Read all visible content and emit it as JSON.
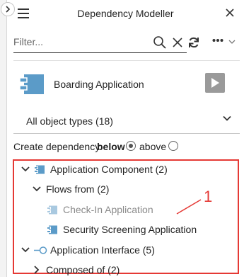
{
  "panel": {
    "title": "Dependency Modeller"
  },
  "filter": {
    "placeholder": "Filter..."
  },
  "element": {
    "label": "Boarding Application"
  },
  "object_types": {
    "selected": "All object types (18)"
  },
  "create_dependency": {
    "prefix": "Create dependency",
    "bold": "below",
    "below_selected": true,
    "above_label": "above"
  },
  "tree": [
    {
      "label": "Application Component (2)",
      "icon": "application-component-icon",
      "expanded": true
    },
    {
      "label": "Flows from (2)",
      "expanded": true
    },
    {
      "label": "Check-In Application",
      "icon": "application-component-icon",
      "disabled": true
    },
    {
      "label": "Security Screening Application",
      "icon": "application-component-icon"
    },
    {
      "label": "Application Interface (5)",
      "icon": "application-interface-icon",
      "expanded": true
    },
    {
      "label": "Composed of (2)",
      "expanded": false
    }
  ],
  "annotation": {
    "number": "1"
  },
  "colors": {
    "accent_blue": "#5b9bc8",
    "highlight_red": "#e53935",
    "play_gray": "#9a9a9a"
  }
}
